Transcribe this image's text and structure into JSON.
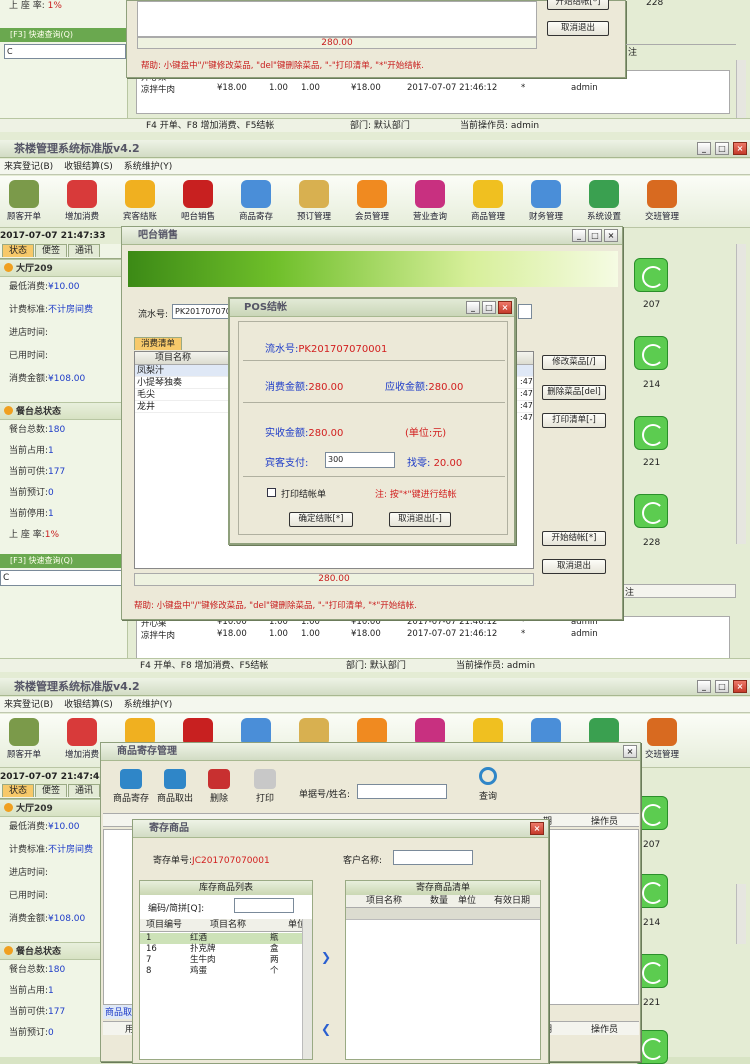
{
  "seg1": {
    "amount": "280.00",
    "help": "帮助: 小键盘中\"/\"键修改菜品, \"del\"键删除菜品, \"-\"打印清单, \"*\"开始结帐.",
    "btn_start": "开始结帐[*]",
    "btn_cancel": "取消退出",
    "rate_label": "上 座 率:",
    "rate_val": "1%",
    "quick_title": "[F3] 快速查询(Q)",
    "quick_val": "C",
    "col_note": "注",
    "room": "228",
    "rows": [
      [
        "开心果",
        "¥10.00",
        "1.00",
        "1.00",
        "¥10.00",
        "2017-07-07 21:46:12",
        "*",
        "admin"
      ],
      [
        "凉拌牛肉",
        "¥18.00",
        "1.00",
        "1.00",
        "¥18.00",
        "2017-07-07 21:46:12",
        "*",
        "admin"
      ]
    ],
    "status": {
      "keys": "F4 开单、F8 增加消费、F5结帐",
      "dept": "部门: 默认部门",
      "op": "当前操作员: admin"
    }
  },
  "app": {
    "title": "茶楼管理系统标准版v4.2",
    "menu": [
      "来宾登记(B)",
      "收银结算(S)",
      "系统维护(Y)"
    ],
    "toolbar": [
      "顾客开单",
      "增加消费",
      "宾客结账",
      "吧台销售",
      "商品寄存",
      "预订管理",
      "会员管理",
      "营业查询",
      "商品管理",
      "财务管理",
      "系统设置",
      "交班管理"
    ],
    "datetime": "2017-07-07 21:47:33",
    "datetime2": "2017-07-07 21:47:48",
    "tabs": [
      "状态",
      "便签",
      "通讯"
    ]
  },
  "left": {
    "hall": "大厅209",
    "min_label": "最低消费:",
    "min_val": "¥10.00",
    "std_label": "计费标准:",
    "std_val": "不计房间费",
    "in_label": "进店时间:",
    "used_label": "已用时间:",
    "cons_label": "消费金额:",
    "cons_val": "¥108.00",
    "total_title": "餐台总状态",
    "total_label": "餐台总数:",
    "total_val": "180",
    "occ_label": "当前占用:",
    "occ_val": "1",
    "avail_label": "当前可供:",
    "avail_val": "177",
    "book_label": "当前预订:",
    "book_val": "0",
    "stop_label": "当前停用:",
    "stop_val": "1",
    "rate_label": "上 座 率:",
    "rate_val": "1%",
    "quick_title": "[F3] 快速查询(Q)",
    "quick_val": "C"
  },
  "rooms": [
    "207",
    "214",
    "221",
    "228"
  ],
  "bar": {
    "title": "吧台销售",
    "serial_label": "流水号:",
    "serial_val": "PK20170707000",
    "tab": "消费清单",
    "col_name": "项目名称",
    "items": [
      "凤梨汁",
      "小提琴独奏",
      "毛尖",
      "龙井"
    ],
    "times": [
      ":47",
      ":47",
      ":47",
      ":47"
    ],
    "btn_edit": "修改菜品[/]",
    "btn_del": "删除菜品[del]",
    "btn_print": "打印清单[-]",
    "btn_start": "开始结帐[*]",
    "btn_cancel": "取消退出",
    "amount": "280.00",
    "col_note": "注",
    "help": "帮助: 小键盘中\"/\"键修改菜品, \"del\"键删除菜品, \"-\"打印清单, \"*\"开始结帐.",
    "rows": [
      [
        "开心果",
        "¥10.00",
        "1.00",
        "1.00",
        "¥10.00",
        "2017-07-07 21:46:12",
        "*",
        "admin"
      ],
      [
        "凉拌牛肉",
        "¥18.00",
        "1.00",
        "1.00",
        "¥18.00",
        "2017-07-07 21:46:12",
        "*",
        "admin"
      ]
    ]
  },
  "pos": {
    "title": "POS结帐",
    "serial_label": "流水号:",
    "serial_val": "PK201707070001",
    "cons_label": "消费金额:",
    "cons_val": "280.00",
    "recv_label": "应收金额:",
    "recv_val": "280.00",
    "paid_label": "实收金额:",
    "paid_val": "280.00",
    "unit": "(单位:元)",
    "pay_label": "宾客支付:",
    "pay_val": "300",
    "change_label": "找零:",
    "change_val": "20.00",
    "print_label": "打印结帐单",
    "note": "注: 按\"*\"键进行结帐",
    "btn_ok": "确定结账[*]",
    "btn_cancel": "取消退出[-]"
  },
  "status2": {
    "keys": "F4 开单、F8 增加消费、F5结帐",
    "dept": "部门: 默认部门",
    "op": "当前操作员: admin"
  },
  "storage": {
    "title": "商品寄存管理",
    "tools": [
      "商品寄存",
      "商品取出",
      "删除",
      "打印"
    ],
    "search_label": "单据号/姓名:",
    "search_btn": "查询",
    "col_period": "期",
    "col_op": "操作员",
    "bottom_tab": "商品取",
    "bottom_label": "用"
  },
  "deposit": {
    "title": "寄存商品",
    "no_label": "寄存单号:",
    "no_val": "JC201707070001",
    "cust_label": "客户名称:",
    "stock_title": "库存商品列表",
    "code_label": "编码/简拼[Q]:",
    "cols": [
      "项目编号",
      "项目名称",
      "单位"
    ],
    "items": [
      [
        "1",
        "红酒",
        "瓶"
      ],
      [
        "16",
        "扑克牌",
        "盒"
      ],
      [
        "7",
        "生牛肉",
        "两"
      ],
      [
        "8",
        "鸡蛋",
        "个"
      ]
    ],
    "list_title": "寄存商品清单",
    "list_cols": [
      "项目名称",
      "数量",
      "单位",
      "有效日期"
    ]
  }
}
